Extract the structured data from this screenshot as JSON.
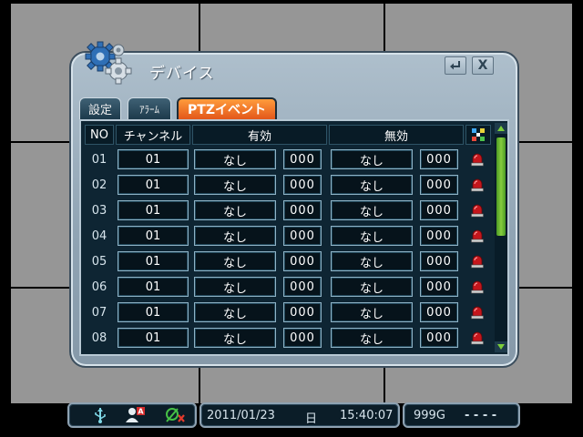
{
  "dialog": {
    "title": "デバイス",
    "enter_btn_icon": "enter-icon",
    "close_label": "X"
  },
  "tabs": [
    {
      "label": "設定",
      "active": false
    },
    {
      "label": "ｱﾗｰﾑ",
      "active": false
    },
    {
      "label": "PTZイベント",
      "active": true
    }
  ],
  "table": {
    "headers": {
      "no": "NO",
      "channel": "チャンネル",
      "enabled": "有効",
      "disabled": "無効",
      "icon": "settings-mix-icon"
    },
    "rows": [
      {
        "no": "01",
        "channel": "01",
        "on_action": "なし",
        "on_preset": "000",
        "off_action": "なし",
        "off_preset": "000"
      },
      {
        "no": "02",
        "channel": "01",
        "on_action": "なし",
        "on_preset": "000",
        "off_action": "なし",
        "off_preset": "000"
      },
      {
        "no": "03",
        "channel": "01",
        "on_action": "なし",
        "on_preset": "000",
        "off_action": "なし",
        "off_preset": "000"
      },
      {
        "no": "04",
        "channel": "01",
        "on_action": "なし",
        "on_preset": "000",
        "off_action": "なし",
        "off_preset": "000"
      },
      {
        "no": "05",
        "channel": "01",
        "on_action": "なし",
        "on_preset": "000",
        "off_action": "なし",
        "off_preset": "000"
      },
      {
        "no": "06",
        "channel": "01",
        "on_action": "なし",
        "on_preset": "000",
        "off_action": "なし",
        "off_preset": "000"
      },
      {
        "no": "07",
        "channel": "01",
        "on_action": "なし",
        "on_preset": "000",
        "off_action": "なし",
        "off_preset": "000"
      },
      {
        "no": "08",
        "channel": "01",
        "on_action": "なし",
        "on_preset": "000",
        "off_action": "なし",
        "off_preset": "000"
      }
    ]
  },
  "statusbar": {
    "date": "2011/01/23",
    "weekday": "日",
    "time": "15:40:07",
    "disk": "999G",
    "extra": "- - - -"
  },
  "colors": {
    "active_tab": "#f07a28",
    "scroll_thumb": "#6bb832",
    "bell": "#c4161c"
  }
}
